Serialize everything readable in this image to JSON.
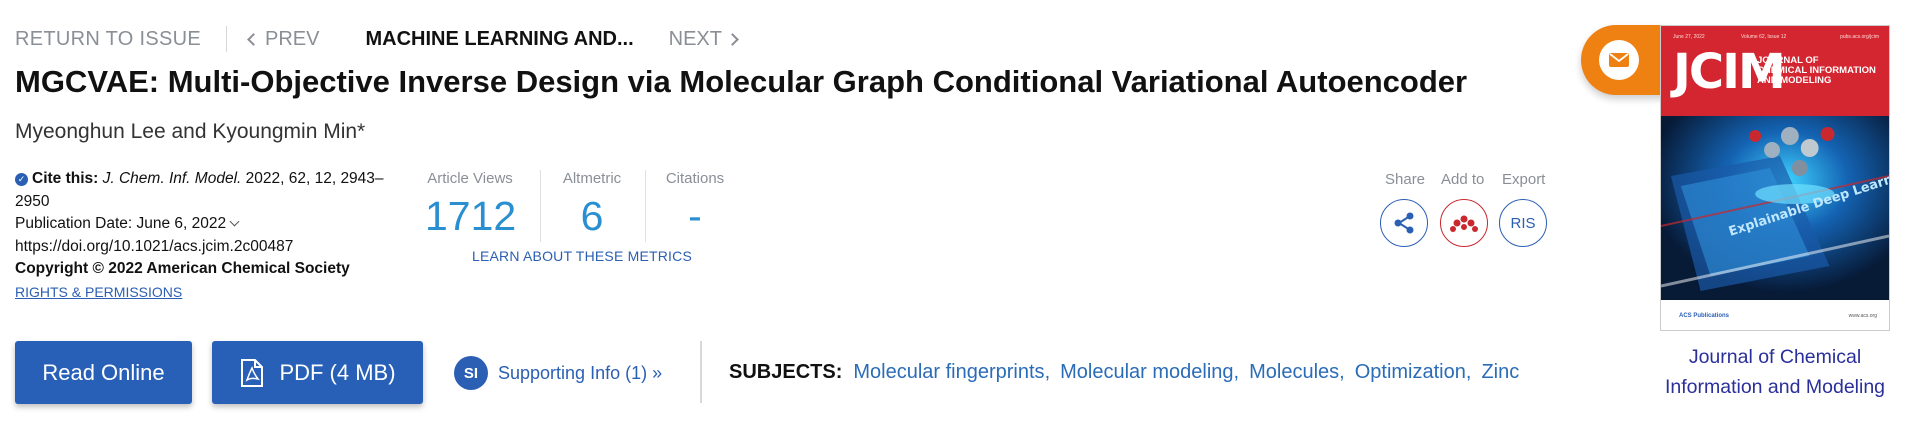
{
  "nav": {
    "return_label": "RETURN TO ISSUE",
    "prev_label": "PREV",
    "current_label": "MACHINE LEARNING AND...",
    "next_label": "NEXT"
  },
  "article": {
    "title": "MGCVAE: Multi-Objective Inverse Design via Molecular Graph Conditional Variational Autoencoder",
    "authors": "Myeonghun Lee and Kyoungmin Min*"
  },
  "citation": {
    "cite_label": "Cite this:",
    "journal": "J. Chem. Inf. Model.",
    "details": "2022, 62, 12, 2943–2950",
    "pub_date": "Publication Date: June 6, 2022",
    "doi": "https://doi.org/10.1021/acs.jcim.2c00487",
    "copyright": "Copyright © 2022 American Chemical Society",
    "rights": "RIGHTS & PERMISSIONS"
  },
  "metrics": {
    "views_label": "Article Views",
    "views_value": "1712",
    "altmetric_label": "Altmetric",
    "altmetric_value": "6",
    "citations_label": "Citations",
    "citations_value": "-",
    "learn_label": "LEARN ABOUT THESE METRICS"
  },
  "actions": {
    "share_label": "Share",
    "addto_label": "Add to",
    "export_label": "Export",
    "export_button": "RIS"
  },
  "buttons": {
    "read_online": "Read Online",
    "pdf": "PDF (4 MB)",
    "si_badge": "SI",
    "supporting_info": "Supporting Info (1) »"
  },
  "subjects": {
    "label": "SUBJECTS:",
    "items": [
      "Molecular fingerprints",
      "Molecular modeling",
      "Molecules",
      "Optimization",
      "Zinc"
    ]
  },
  "cover": {
    "date_line": "June 27, 2022",
    "volume_line": "Volume 62, Issue 12",
    "site_line": "pubs.acs.org/jcim",
    "logo": "JCIM",
    "journal_line1": "JOURNAL OF",
    "journal_line2": "CHEMICAL INFORMATION",
    "journal_line3": "AND MODELING",
    "art_text": "Explainable Deep Learning",
    "publisher": "ACS Publications",
    "footer_site": "www.acs.org"
  },
  "journal_link": "Journal of Chemical Information and Modeling",
  "colors": {
    "primary_blue": "#2860b8",
    "metric_blue": "#2a8fd0",
    "accent_orange": "#ef8012",
    "cover_red": "#d32630"
  }
}
